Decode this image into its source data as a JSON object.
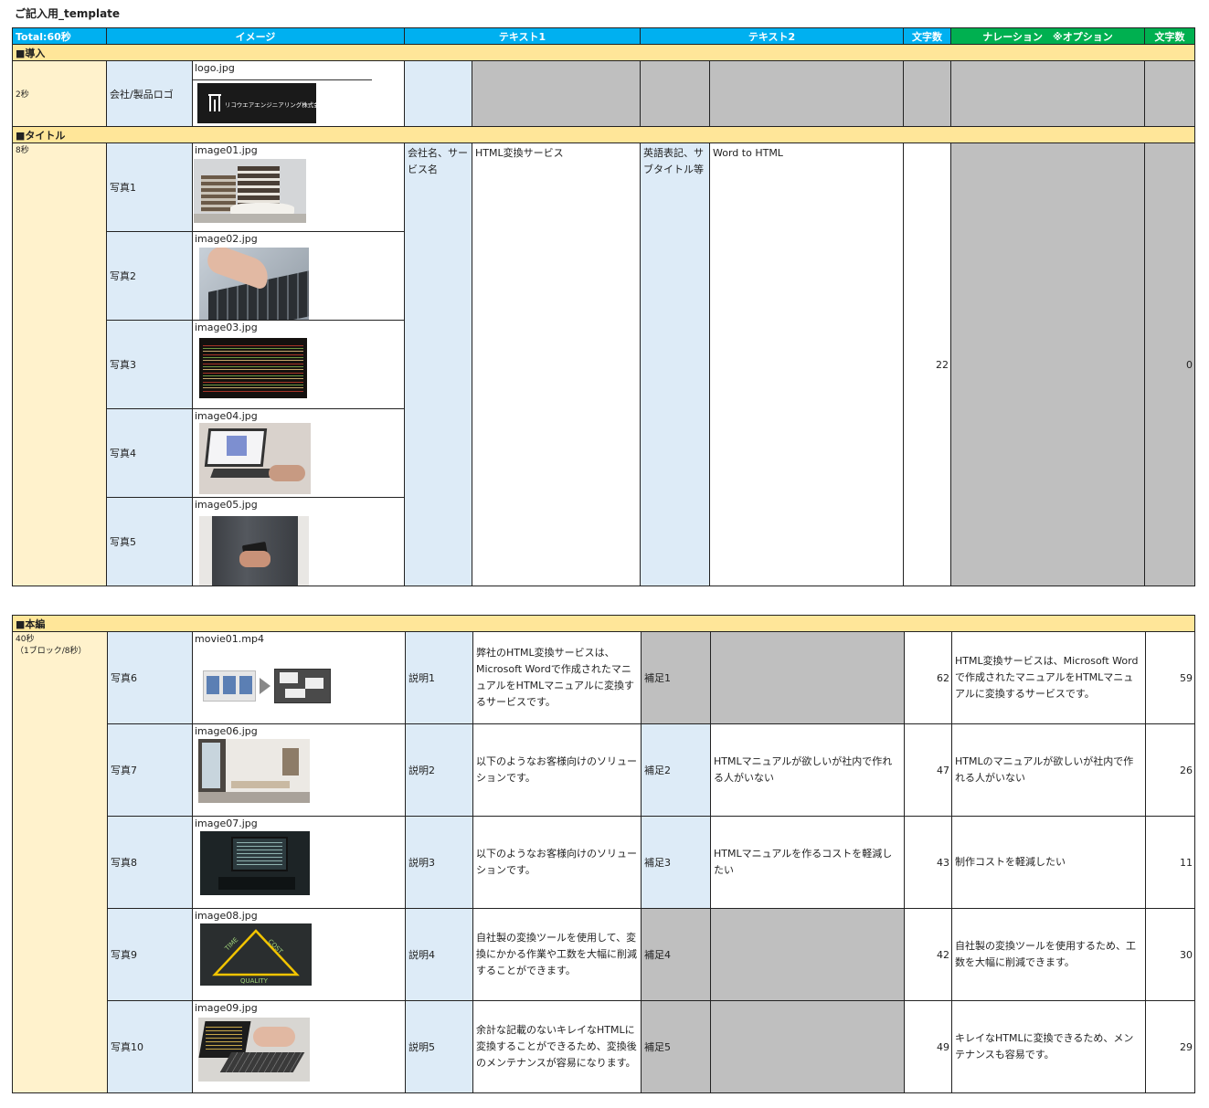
{
  "sheet_title": "ご記入用_template",
  "header": {
    "total": "Total:60秒",
    "image": "イメージ",
    "text1": "テキスト1",
    "text2": "テキスト2",
    "chars": "文字数",
    "narration": "ナレーション　※オプション",
    "chars2": "文字数"
  },
  "intro": {
    "section": "■導入",
    "time": "2秒",
    "label": "会社/製品ロゴ",
    "file": "logo.jpg",
    "logo_text": "リコウエアエンジニアリング株式会社"
  },
  "title_sec": {
    "section": "■タイトル",
    "time": "8秒",
    "text1_label": "会社名、サービス名",
    "text1_value": "HTML変換サービス",
    "text2_label": "英語表記、サブタイトル等",
    "text2_value": "Word to HTML",
    "chars": "22",
    "chars2": "0",
    "photos": [
      {
        "label": "写真1",
        "file": "image01.jpg",
        "icon": "books-photo"
      },
      {
        "label": "写真2",
        "file": "image02.jpg",
        "icon": "keyboard-photo"
      },
      {
        "label": "写真3",
        "file": "image03.jpg",
        "icon": "code-photo"
      },
      {
        "label": "写真4",
        "file": "image04.jpg",
        "icon": "laptop-photo"
      },
      {
        "label": "写真5",
        "file": "image05.jpg",
        "icon": "smartphone-photo"
      }
    ]
  },
  "main_sec": {
    "section": "■本編",
    "time": "40秒\n（1ブロック/8秒）",
    "rows": [
      {
        "label": "写真6",
        "file": "movie01.mp4",
        "desc_label": "説明1",
        "desc": "弊社のHTML変換サービスは、Microsoft Wordで作成されたマニュアルをHTMLマニュアルに変換するサービスです。",
        "sup_label": "補足1",
        "sup": "",
        "chars": "62",
        "narration": "HTML変換サービスは、Microsoft Wordで作成されたマニュアルをHTMLマニュアルに変換するサービスです。",
        "chars2": "59"
      },
      {
        "label": "写真7",
        "file": "image06.jpg",
        "desc_label": "説明2",
        "desc": "以下のようなお客様向けのソリューションです。",
        "sup_label": "補足2",
        "sup": "HTMLマニュアルが欲しいが社内で作れる人がいない",
        "chars": "47",
        "narration": "HTMLのマニュアルが欲しいが社内で作れる人がいない",
        "chars2": "26"
      },
      {
        "label": "写真8",
        "file": "image07.jpg",
        "desc_label": "説明3",
        "desc": "以下のようなお客様向けのソリューションです。",
        "sup_label": "補足3",
        "sup": "HTMLマニュアルを作るコストを軽減したい",
        "chars": "43",
        "narration": "制作コストを軽減したい",
        "chars2": "11"
      },
      {
        "label": "写真9",
        "file": "image08.jpg",
        "desc_label": "説明4",
        "desc": "自社製の変換ツールを使用して、変換にかかる作業や工数を大幅に削減することができます。",
        "sup_label": "補足4",
        "sup": "",
        "chars": "42",
        "narration": "自社製の変換ツールを使用するため、工数を大幅に削減できます。",
        "chars2": "30"
      },
      {
        "label": "写真10",
        "file": "image09.jpg",
        "desc_label": "説明5",
        "desc": "余計な記載のないキレイなHTMLに変換することができるため、変換後のメンテナンスが容易になります。",
        "sup_label": "補足5",
        "sup": "",
        "chars": "49",
        "narration": "キレイなHTMLに変換できるため、メンテナンスも容易です。",
        "chars2": "29"
      }
    ],
    "triangle_words": [
      "TIME",
      "COST",
      "QUALITY"
    ]
  },
  "colors": {
    "header_blue": "#00b0f0",
    "header_green": "#00b050",
    "section_yellow": "#ffe699",
    "time_cell": "#fff2cc",
    "label_cell": "#ddebf7",
    "gray_cell": "#bfbfbf"
  }
}
